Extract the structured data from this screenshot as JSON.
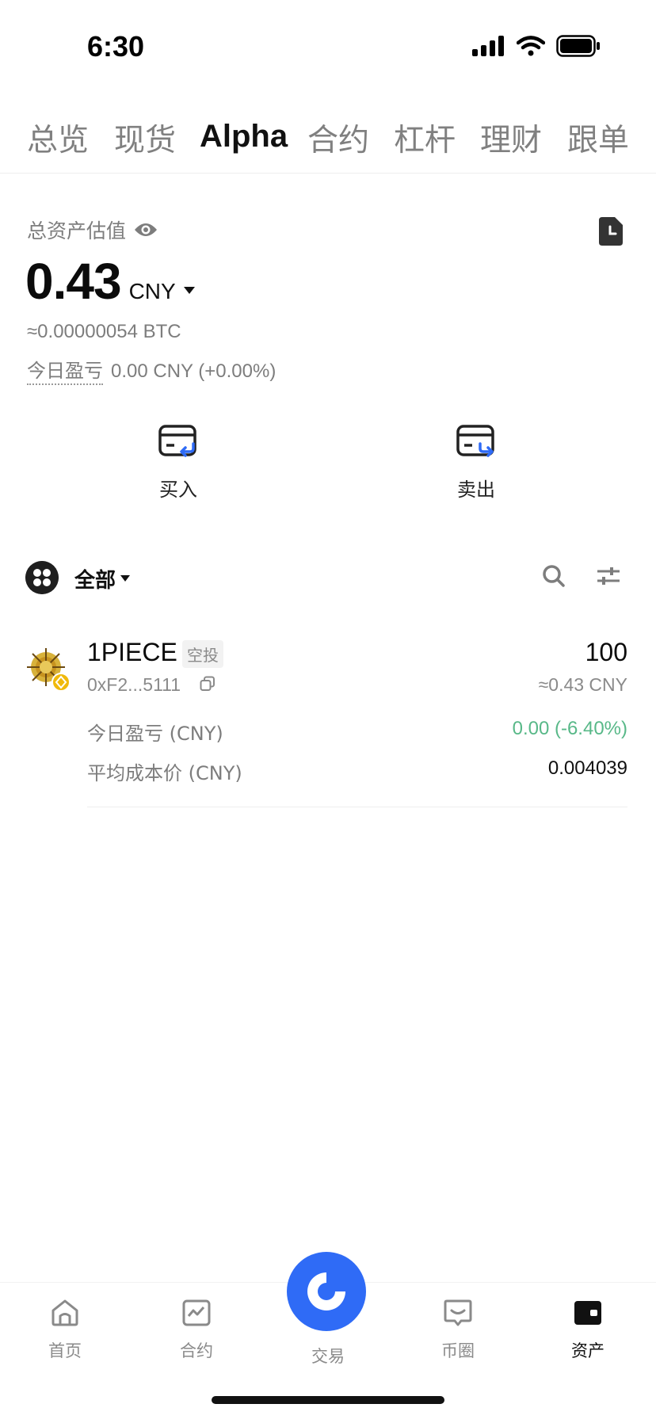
{
  "status_bar": {
    "time": "6:30"
  },
  "tabs": [
    {
      "label": "总览",
      "active": false
    },
    {
      "label": "现货",
      "active": false
    },
    {
      "label": "Alpha",
      "active": true
    },
    {
      "label": "合约",
      "active": false
    },
    {
      "label": "杠杆",
      "active": false
    },
    {
      "label": "理财",
      "active": false
    },
    {
      "label": "跟单",
      "active": false
    }
  ],
  "summary": {
    "label": "总资产估值",
    "balance": "0.43",
    "currency": "CNY",
    "btc_value": "≈0.00000054 BTC",
    "pnl_label": "今日盈亏",
    "pnl_value": "0.00 CNY (+0.00%)"
  },
  "actions": {
    "buy": "买入",
    "sell": "卖出"
  },
  "filter": {
    "label": "全部"
  },
  "tokens": [
    {
      "name": "1PIECE",
      "tag": "空投",
      "address": "0xF2...5111",
      "amount": "100",
      "value": "≈0.43 CNY",
      "pnl_label": "今日盈亏 (CNY)",
      "pnl_value": "0.00 (-6.40%)",
      "cost_label": "平均成本价 (CNY)",
      "cost_value": "0.004039"
    }
  ],
  "bottom_nav": {
    "home": "首页",
    "futures": "合约",
    "trade": "交易",
    "square": "币圈",
    "assets": "资产"
  },
  "colors": {
    "accent": "#2f6bf6",
    "positive": "#58b888",
    "muted": "#7d7d7d"
  }
}
